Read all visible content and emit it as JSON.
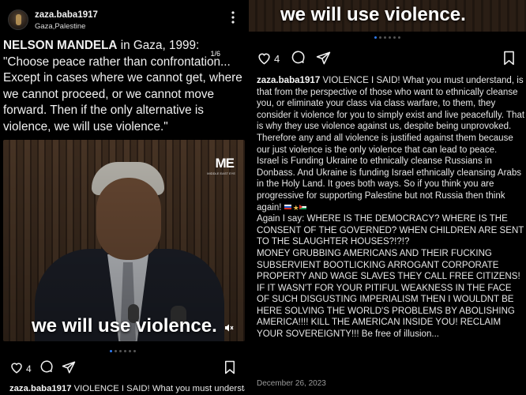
{
  "left_post": {
    "username": "zaza.baba1917",
    "location": "Gaza,Palestine",
    "quote_name": "NELSON MANDELA",
    "quote_text": " in Gaza, 1999: \"Choose peace rather than confrontation... Except in cases where we cannot get, where we cannot proceed, or we cannot move forward. Then if the only alternative is violence, we will use violence.\"",
    "slide_counter": "1/6",
    "video_caption": "we will use violence.",
    "watermark": "ME",
    "watermark_sub": "MIDDLE EAST EYE",
    "like_count": "4",
    "caption_user": "zaza.baba1917",
    "caption_preview": " VIOLENCE I SAID! What you must understand,"
  },
  "right_post": {
    "video_caption": "we will use violence.",
    "like_count": "4",
    "caption_user": "zaza.baba1917",
    "paragraphs": [
      " VIOLENCE I SAID! What you must understand, is that from the perspective of those who want to ethnically cleanse you, or eliminate your class via class warfare, to them, they consider it violence for you to simply exist and live peacefully. That is why they use violence against us, despite being unprovoked. Therefore any and all violence is justified against them because our just violence is the only violence that can lead to peace.",
      "Israel is Funding Ukraine to ethnically cleanse Russians in Donbass. And Ukraine is funding Israel ethnically cleansing Arabs in the Holy Land. It goes both ways. So if you think you are progressive for supporting Palestine but not Russia then think again!",
      "Again I say: WHERE IS THE DEMOCRACY? WHERE IS THE CONSENT OF THE GOVERNED? WHEN CHILDREN ARE SENT TO THE SLAUGHTER HOUSES?!?!?",
      "MONEY GRUBBING AMERICANS AND THEIR FUCKING SUBSERVIENT BOOTLICKING ARROGANT CORPORATE PROPERTY AND WAGE SLAVES THEY CALL FREE CITIZENS! IF IT WASN'T FOR YOUR PITIFUL WEAKNESS IN THE FACE OF SUCH DISGUSTING IMPERIALISM THEN I WOULDNT BE HERE SOLVING THE WORLD'S PROBLEMS BY ABOLISHING AMERICA!!!! KILL THE AMERICAN INSIDE YOU! RECLAIM YOUR SOVEREIGNTY!!! Be free of illusion..."
    ],
    "date": "December 26, 2023"
  },
  "icons": [
    "more-icon",
    "heart-icon",
    "comment-icon",
    "share-icon",
    "bookmark-icon",
    "mute-icon"
  ],
  "colors": {
    "background": "#000000",
    "active_dot": "#2f7cf6",
    "text": "#f0f0f0",
    "date": "#9a9a9a"
  }
}
